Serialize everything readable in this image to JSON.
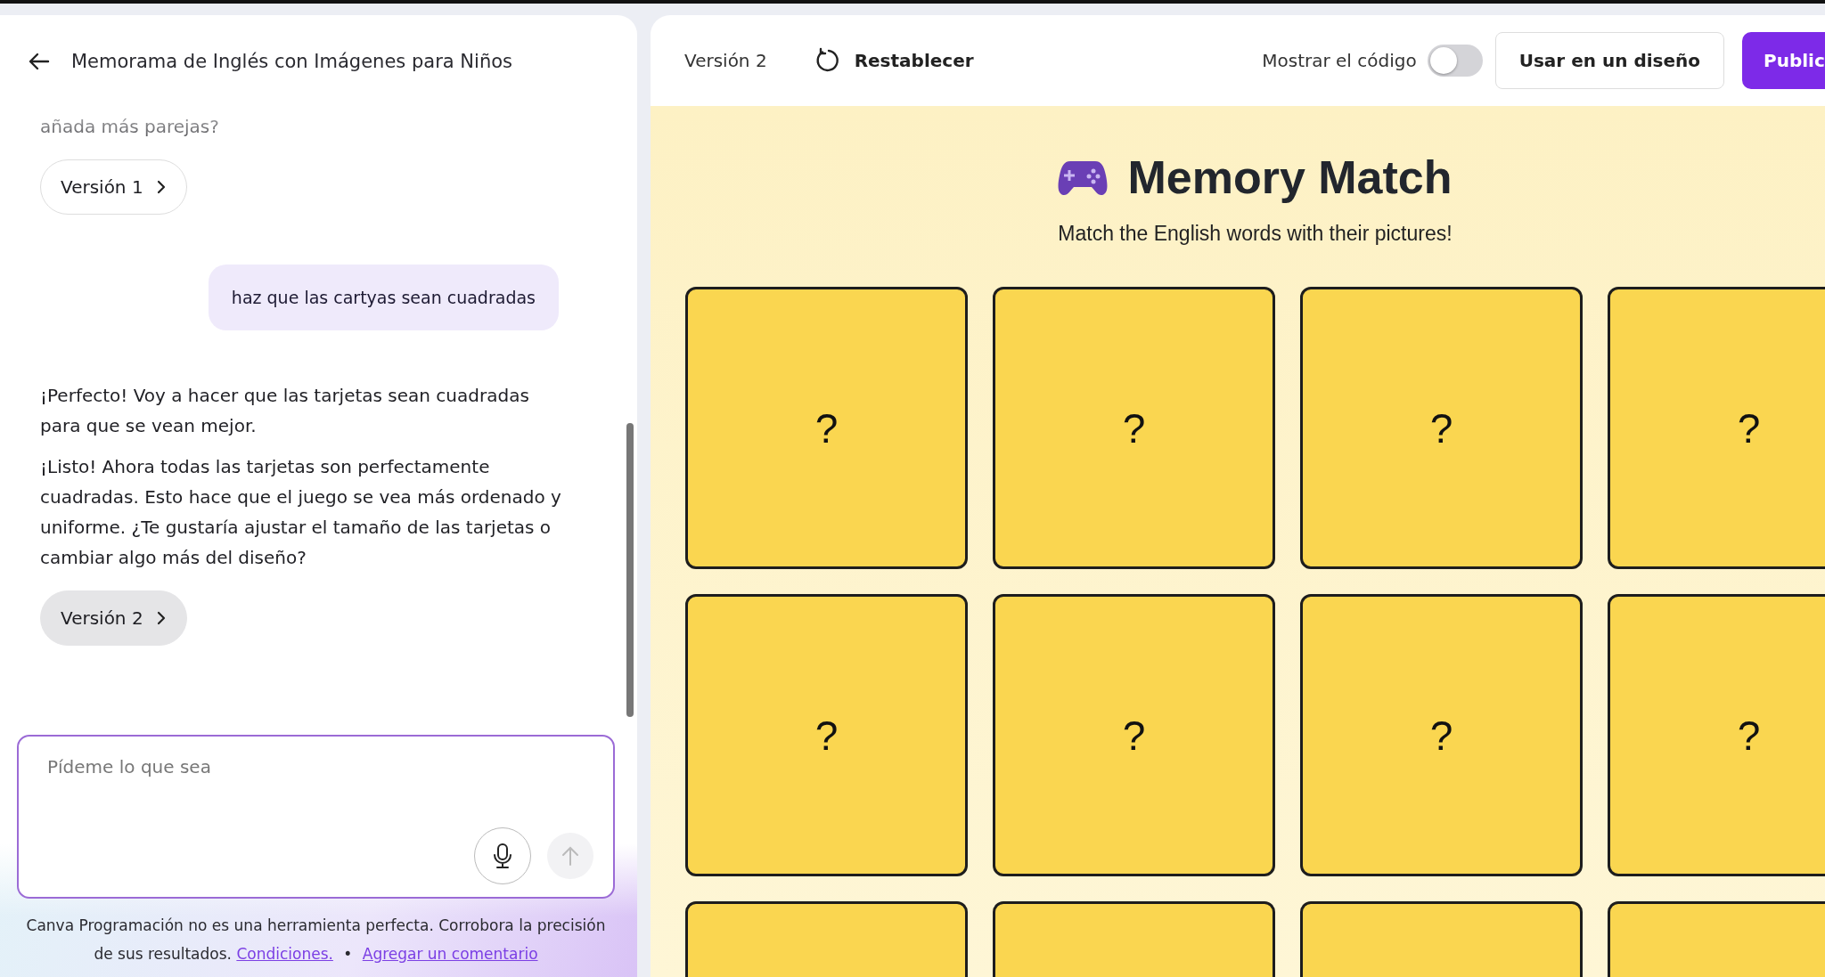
{
  "chat_panel": {
    "title": "Memorama de Inglés con Imágenes para Niños",
    "messages": [
      {
        "kind": "assistant",
        "text": "añada más parejas?"
      },
      {
        "kind": "version",
        "label": "Versión 1",
        "selected": false
      },
      {
        "kind": "user",
        "text": "haz que las cartyas sean cuadradas"
      },
      {
        "kind": "assistant",
        "text": "¡Perfecto! Voy a hacer que las tarjetas sean cuadradas para que se vean mejor."
      },
      {
        "kind": "assistant",
        "text": "¡Listo! Ahora todas las tarjetas son perfectamente cuadradas. Esto hace que el juego se vea más ordenado y uniforme. ¿Te gustaría ajustar el tamaño de las tarjetas o cambiar algo más del diseño?"
      },
      {
        "kind": "version",
        "label": "Versión 2",
        "selected": true
      }
    ],
    "input": {
      "placeholder": "Pídeme lo que sea"
    },
    "send_disabled": true,
    "disclaimer": "Canva Programación no es una herramienta perfecta. Corrobora la precisión de sus resultados.",
    "links": [
      "Condiciones.",
      "Agregar un comentario"
    ],
    "separator": "•"
  },
  "toolbar": {
    "version": "Versión 2",
    "reset": "Restablecer",
    "show_code": {
      "label": "Mostrar el código",
      "on": false
    },
    "use_button": "Usar en un diseño",
    "publish_button": "Public"
  },
  "game": {
    "title": "Memory Match",
    "subtitle": "Match the English words with their pictures!",
    "cards": [
      {
        "kind": "face_down",
        "label": "?"
      },
      {
        "kind": "face_down",
        "label": "?"
      },
      {
        "kind": "face_down",
        "label": "?"
      },
      {
        "kind": "face_down",
        "label": "?"
      },
      {
        "kind": "face_down",
        "label": "?"
      },
      {
        "kind": "face_down",
        "label": "?"
      },
      {
        "kind": "face_down",
        "label": "?"
      },
      {
        "kind": "face_down",
        "label": "?"
      },
      {
        "kind": "face_down"
      },
      {
        "kind": "face_down"
      },
      {
        "kind": "face_down"
      },
      {
        "kind": "face_down"
      }
    ]
  }
}
